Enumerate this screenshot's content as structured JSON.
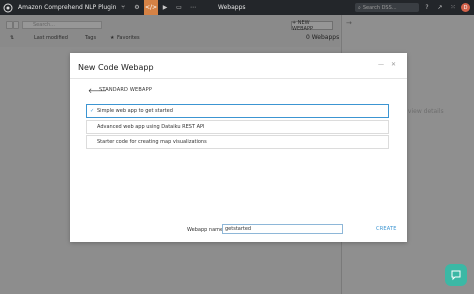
{
  "topbar": {
    "project_title": "Amazon Comprehend NLP Plugin",
    "breadcrumb": "Webapps",
    "search_placeholder": "Search DSS...",
    "avatar_initial": "D",
    "nav_icons": [
      "flow-icon",
      "code-icon",
      "code-active-icon",
      "play-icon",
      "dashboard-icon",
      "more-icon"
    ],
    "right_icons": [
      "help-icon",
      "trend-icon",
      "grid-icon"
    ]
  },
  "filterbar": {
    "search_placeholder": "Search...",
    "sort_label": "Last modified",
    "tags_label": "Tags",
    "favorites_label": "Favorites",
    "new_button_label": "+ NEW WEBAPP",
    "count_label": "0 Webapps"
  },
  "right_panel": {
    "hint": "to view details"
  },
  "modal": {
    "title": "New Code Webapp",
    "section_title": "STANDARD WEBAPP",
    "options": [
      {
        "label": "Simple web app to get started",
        "selected": true
      },
      {
        "label": "Advanced web app using Dataiku REST API",
        "selected": false
      },
      {
        "label": "Starter code for creating map visualizations",
        "selected": false
      }
    ],
    "name_label": "Webapp name",
    "name_value": "getstarted",
    "create_label": "CREATE"
  },
  "colors": {
    "accent": "#3c95d2",
    "active_nav": "#d58245",
    "chat": "#3bb8a5"
  }
}
